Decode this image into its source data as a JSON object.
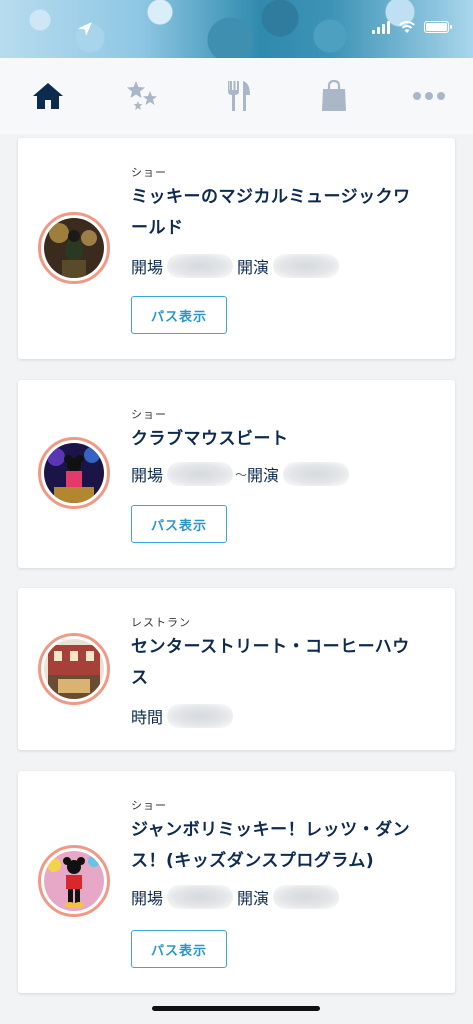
{
  "nav": {
    "tabs": [
      {
        "icon": "home-icon",
        "active": true
      },
      {
        "icon": "sparkle-stars-icon",
        "active": false
      },
      {
        "icon": "fork-knife-icon",
        "active": false
      },
      {
        "icon": "shopping-bag-icon",
        "active": false
      },
      {
        "icon": "more-dots-icon",
        "active": false
      }
    ]
  },
  "cards": [
    {
      "category": "ショー",
      "title_line1": "ミッキーのマジカルミュージックワ",
      "title_line2": "ールド",
      "label1": "開場",
      "label2": "開演",
      "button": "パス表示"
    },
    {
      "category": "ショー",
      "title_line1": "クラブマウスビート",
      "label1": "開場",
      "separator": "〜",
      "label2": "開演",
      "button": "パス表示"
    },
    {
      "category": "レストラン",
      "title_line1": "センターストリート・コーヒーハウ",
      "title_line2": "ス",
      "label1": "時間"
    },
    {
      "category": "ショー",
      "title_line1": "ジャンボリミッキー！レッツ・ダン",
      "title_line2": "ス！(キッズダンスプログラム)",
      "label1": "開場",
      "label2": "開演",
      "button": "パス表示"
    }
  ],
  "colors": {
    "title": "#0d2a4f",
    "accent": "#2a97c9",
    "avatar_border": "#f09a86",
    "nav_active": "#0d2a4f",
    "nav_inactive": "#a9b7c6"
  }
}
